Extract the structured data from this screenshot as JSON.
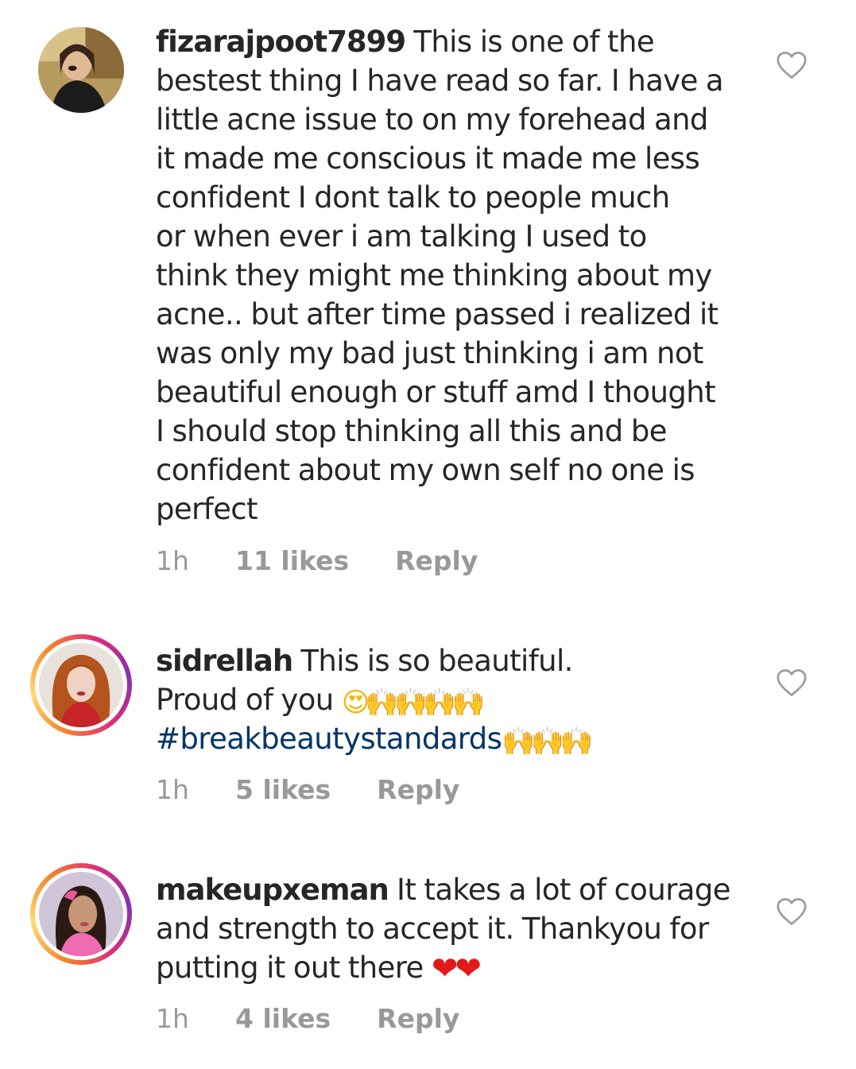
{
  "comments": [
    {
      "username": "fizarajpoot7899",
      "lines": [
        " This is one of the",
        "bestest thing I have read so far. I have a",
        "little acne issue to on my forehead and",
        "it made me conscious it made me less",
        "confident I dont talk to people much",
        "or when ever i am talking I used to",
        "think they might me thinking about my",
        "acne.. but after time passed i realized it",
        "was only my bad just thinking i am not",
        "beautiful enough or stuff amd I thought",
        "I should stop thinking all this and be",
        "confident about my own self no one is",
        "perfect"
      ],
      "time": "1h",
      "likes": "11 likes",
      "reply": "Reply",
      "avatar_story_ring": false
    },
    {
      "username": "sidrellah",
      "line1": " This is so beautiful.",
      "line2_text": "Proud of you ",
      "line2_emoji_face": "😍",
      "line2_emoji_hands": "🙌🙌🙌🙌",
      "hashtag": "#breakbeautystandards",
      "line3_emoji_hands": " 🙌🙌🙌",
      "time": "1h",
      "likes": "5 likes",
      "reply": "Reply",
      "avatar_story_ring": true
    },
    {
      "username": "makeupxeman",
      "line1": " It takes a lot of courage",
      "line2": "and strength to accept it. Thankyou for",
      "line3_text": "putting it out there ",
      "line3_emoji": "❤❤",
      "time": "1h",
      "likes": "4 likes",
      "reply": "Reply",
      "avatar_story_ring": true
    }
  ],
  "icons": {
    "like": "heart-outline-icon"
  },
  "colors": {
    "text": "#262626",
    "meta": "#999999",
    "hashtag": "#003569",
    "story_ring": [
      "#f58529",
      "#dd2a7b",
      "#8134af"
    ]
  }
}
